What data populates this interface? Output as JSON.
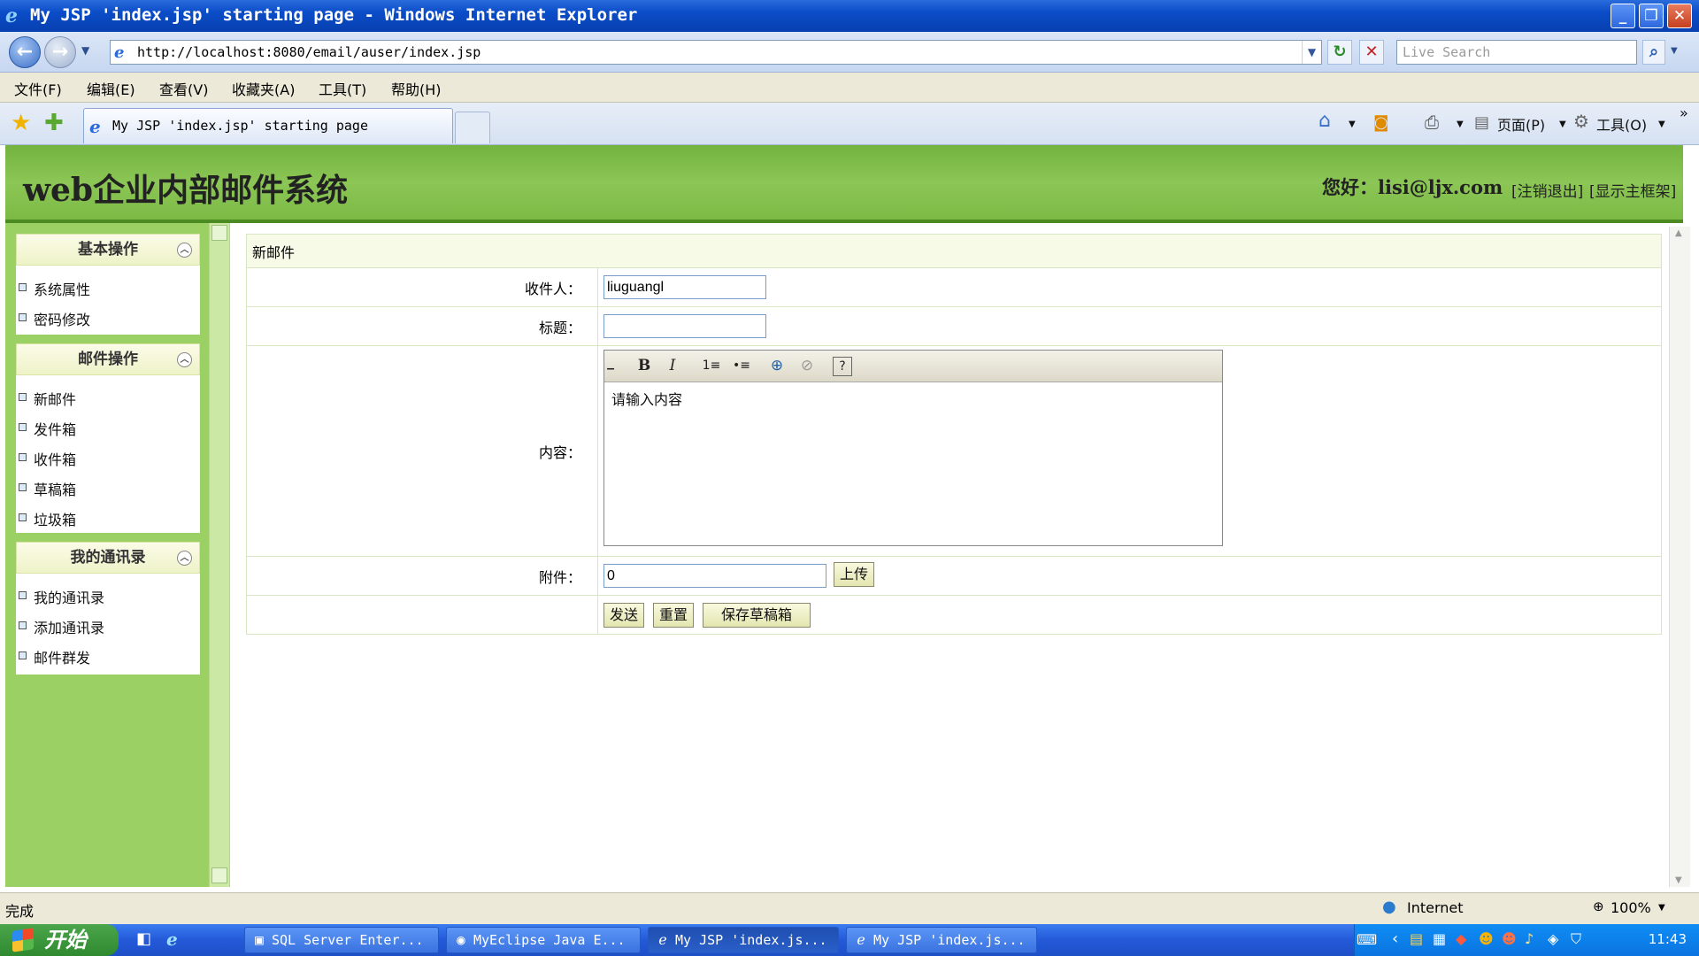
{
  "window": {
    "title": "My JSP 'index.jsp' starting page - Windows Internet Explorer",
    "minimize": "_",
    "restore": "❐",
    "close": "✕"
  },
  "address": {
    "url": "http://localhost:8080/email/auser/index.jsp",
    "search_placeholder": "Live Search"
  },
  "menu": [
    "文件(F)",
    "编辑(E)",
    "查看(V)",
    "收藏夹(A)",
    "工具(T)",
    "帮助(H)"
  ],
  "tab": {
    "title": "My JSP 'index.jsp' starting page"
  },
  "commandbar": {
    "page": "页面(P)",
    "tools": "工具(O)"
  },
  "header": {
    "site_title": "web企业内部邮件系统",
    "greeting": "您好：lisi@ljx.com",
    "logout": "[注销退出]",
    "show_frame": "[显示主框架]"
  },
  "sidebar": {
    "groups": [
      {
        "title": "基本操作",
        "items": [
          "系统属性",
          "密码修改"
        ]
      },
      {
        "title": "邮件操作",
        "items": [
          "新邮件",
          "发件箱",
          "收件箱",
          "草稿箱",
          "垃圾箱"
        ]
      },
      {
        "title": "我的通讯录",
        "items": [
          "我的通讯录",
          "添加通讯录",
          "邮件群发"
        ]
      }
    ]
  },
  "form": {
    "heading": "新邮件",
    "to_label": "收件人：",
    "to_value": "liuguangl",
    "subject_label": "标题：",
    "subject_value": "",
    "content_label": "内容：",
    "content_placeholder": "请输入内容",
    "attachment_label": "附件：",
    "attachment_value": "0",
    "upload_button": "上传",
    "send_button": "发送",
    "reset_button": "重置",
    "save_draft_button": "保存草稿箱"
  },
  "editor_tools": {
    "bold": "B",
    "italic": "I",
    "ordered": "1≡",
    "unordered": "•≡",
    "link": "⊕",
    "unlink": "⊘",
    "help": "?"
  },
  "statusbar": {
    "status": "完成",
    "zone": "Internet",
    "zoom": "100%"
  },
  "taskbar": {
    "start": "开始",
    "tasks": [
      "SQL Server Enter...",
      "MyEclipse Java E...",
      "My JSP 'index.js...",
      "My JSP 'index.js..."
    ],
    "clock": "11:43"
  },
  "colors": {
    "header_green": "#7cba45",
    "sidebar_green": "#9bd065",
    "titlebar_blue": "#0a4cc7"
  }
}
